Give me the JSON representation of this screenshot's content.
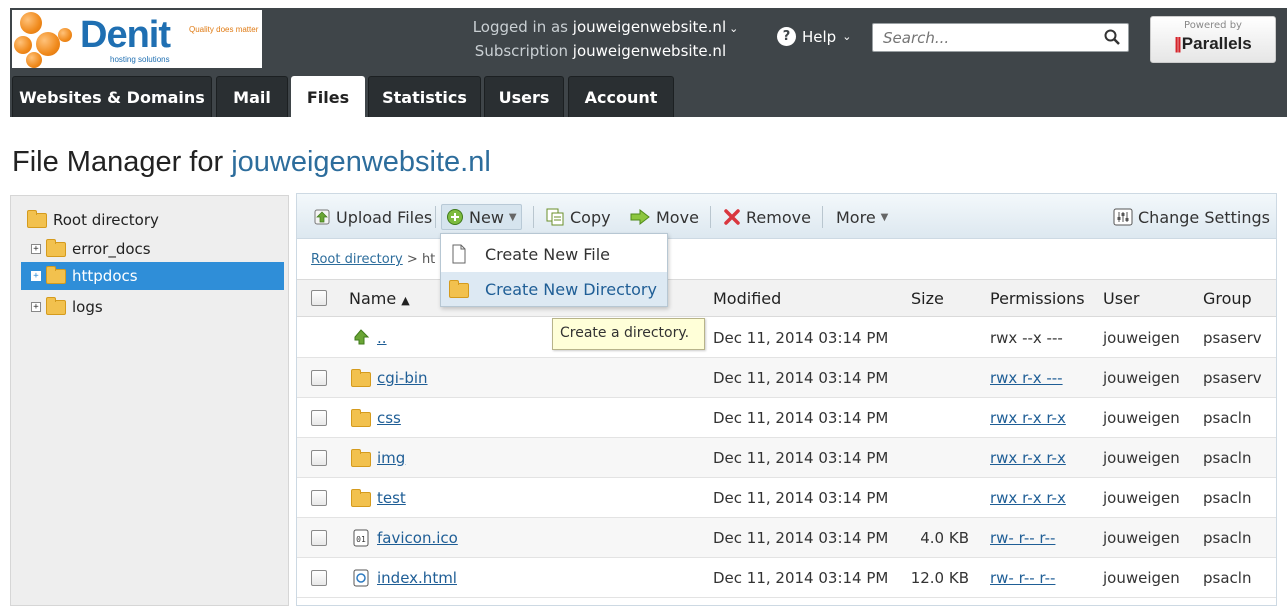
{
  "logo": {
    "name": "Denit",
    "tagline": "Quality does matter",
    "sub": "hosting solutions"
  },
  "account": {
    "logged_in_label": "Logged in as",
    "logged_in_value": "jouweigenwebsite.nl",
    "subscription_label": "Subscription",
    "subscription_value": "jouweigenwebsite.nl"
  },
  "help": {
    "label": "Help"
  },
  "search": {
    "placeholder": "Search..."
  },
  "parallels": {
    "powered_by": "Powered by",
    "brand": "Parallels"
  },
  "tabs": [
    {
      "label": "Websites & Domains",
      "active": false
    },
    {
      "label": "Mail",
      "active": false
    },
    {
      "label": "Files",
      "active": true
    },
    {
      "label": "Statistics",
      "active": false
    },
    {
      "label": "Users",
      "active": false
    },
    {
      "label": "Account",
      "active": false
    }
  ],
  "page_title": {
    "prefix": "File Manager for",
    "domain": "jouweigenwebsite.nl"
  },
  "tree": {
    "root": "Root directory",
    "items": [
      {
        "label": "error_docs",
        "selected": false
      },
      {
        "label": "httpdocs",
        "selected": true
      },
      {
        "label": "logs",
        "selected": false
      }
    ]
  },
  "toolbar": {
    "upload": "Upload Files",
    "new": "New",
    "copy": "Copy",
    "move": "Move",
    "remove": "Remove",
    "more": "More",
    "change_settings": "Change Settings"
  },
  "breadcrumb": {
    "root": "Root directory",
    "separator": ">",
    "current": "ht"
  },
  "new_menu": {
    "items": [
      {
        "label": "Create New File"
      },
      {
        "label": "Create New Directory"
      }
    ]
  },
  "tooltip": "Create a directory.",
  "table": {
    "columns": {
      "name": "Name",
      "modified": "Modified",
      "size": "Size",
      "permissions": "Permissions",
      "user": "User",
      "group": "Group"
    },
    "rows": [
      {
        "name": "..",
        "type": "up",
        "modified": "Dec 11, 2014 03:14 PM",
        "size": "",
        "permissions": "rwx --x ---",
        "perm_link": false,
        "user": "jouweigen",
        "group": "psaserv"
      },
      {
        "name": "cgi-bin",
        "type": "folder",
        "modified": "Dec 11, 2014 03:14 PM",
        "size": "",
        "permissions": "rwx r-x ---",
        "perm_link": true,
        "user": "jouweigen",
        "group": "psaserv"
      },
      {
        "name": "css",
        "type": "folder",
        "modified": "Dec 11, 2014 03:14 PM",
        "size": "",
        "permissions": "rwx r-x r-x",
        "perm_link": true,
        "user": "jouweigen",
        "group": "psacln"
      },
      {
        "name": "img",
        "type": "folder",
        "modified": "Dec 11, 2014 03:14 PM",
        "size": "",
        "permissions": "rwx r-x r-x",
        "perm_link": true,
        "user": "jouweigen",
        "group": "psacln"
      },
      {
        "name": "test",
        "type": "folder",
        "modified": "Dec 11, 2014 03:14 PM",
        "size": "",
        "permissions": "rwx r-x r-x",
        "perm_link": true,
        "user": "jouweigen",
        "group": "psacln"
      },
      {
        "name": "favicon.ico",
        "type": "binary",
        "modified": "Dec 11, 2014 03:14 PM",
        "size": "4.0 KB",
        "permissions": "rw- r-- r--",
        "perm_link": true,
        "user": "jouweigen",
        "group": "psacln"
      },
      {
        "name": "index.html",
        "type": "html",
        "modified": "Dec 11, 2014 03:14 PM",
        "size": "12.0 KB",
        "permissions": "rw- r-- r--",
        "perm_link": true,
        "user": "jouweigen",
        "group": "psacln"
      }
    ]
  }
}
